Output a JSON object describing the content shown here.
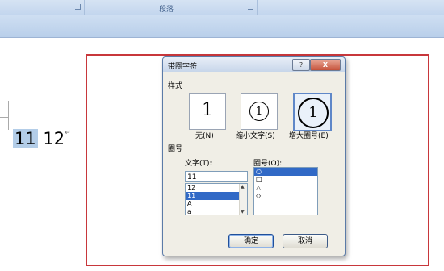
{
  "ribbon": {
    "group_label": "段落"
  },
  "document": {
    "text_selected": "11",
    "text_rest": "12",
    "paragraph_mark": "↵"
  },
  "dialog": {
    "title": "带圈字符",
    "help_glyph": "?",
    "close_glyph": "X",
    "style_section": "样式",
    "styles": [
      {
        "glyph": "1",
        "label": "无(N)"
      },
      {
        "glyph": "1",
        "label": "缩小文字(S)"
      },
      {
        "glyph": "1",
        "label": "增大圈号(E)"
      }
    ],
    "ring_section": "圈号",
    "text_label": "文字(T):",
    "text_value": "11",
    "text_list": [
      "12",
      "11",
      "A",
      "a"
    ],
    "text_list_selected_index": 1,
    "ring_label": "圈号(O):",
    "ring_list": [
      "○",
      "□",
      "△",
      "◇"
    ],
    "ring_list_selected_index": 0,
    "ok_button": "确定",
    "cancel_button": "取消"
  },
  "colors": {
    "highlight_frame": "#c8373b",
    "selection": "#3169c6"
  }
}
